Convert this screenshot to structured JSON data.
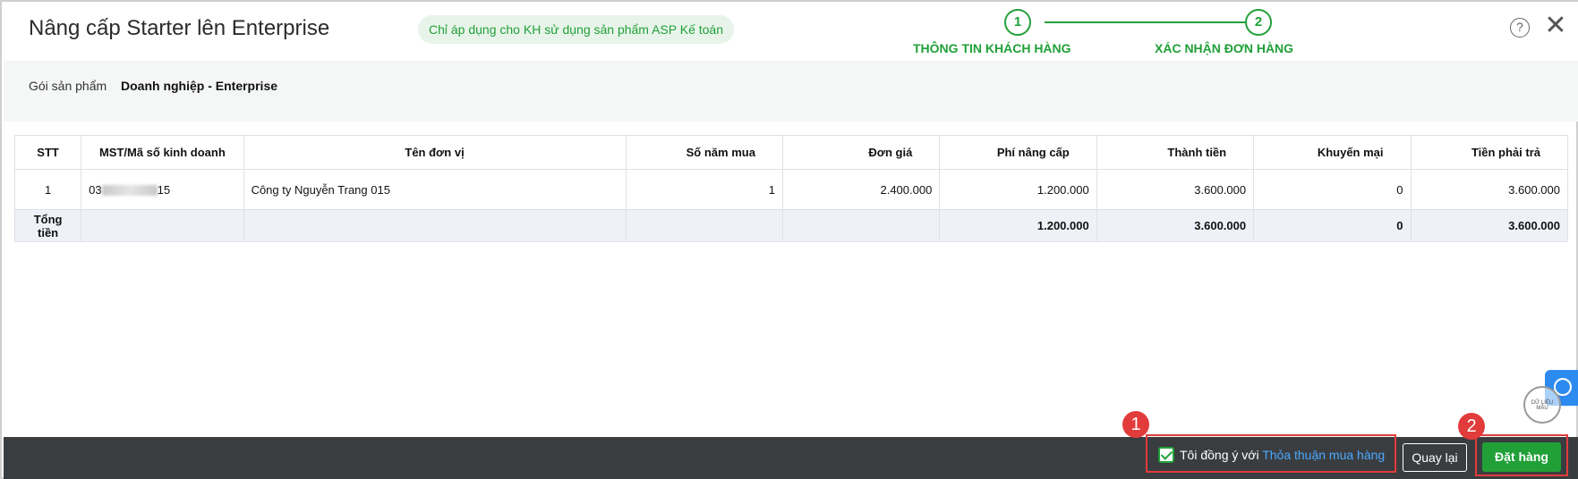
{
  "header": {
    "title": "Nâng cấp Starter lên Enterprise",
    "note": "Chỉ áp dụng cho KH sử dụng sản phẩm ASP Kế toán",
    "steps": [
      {
        "number": "1",
        "label": "THÔNG TIN KHÁCH HÀNG"
      },
      {
        "number": "2",
        "label": "XÁC NHẬN ĐƠN HÀNG"
      }
    ],
    "help_label": "?",
    "close_label": "✕"
  },
  "product": {
    "label": "Gói sản phẩm",
    "value": "Doanh nghiệp - Enterprise"
  },
  "table": {
    "headers": [
      "STT",
      "MST/Mã số kinh doanh",
      "Tên đơn vị",
      "Số năm mua",
      "Đơn giá",
      "Phí nâng cấp",
      "Thành tiền",
      "Khuyến mại",
      "Tiền phải trả"
    ],
    "rows": [
      {
        "stt": "1",
        "mst_prefix": "03",
        "mst_suffix": "15",
        "ten_don_vi": "Công ty Nguyễn Trang 015",
        "so_nam_mua": "1",
        "don_gia": "2.400.000",
        "phi_nang_cap": "1.200.000",
        "thanh_tien": "3.600.000",
        "khuyen_mai": "0",
        "tien_phai_tra": "3.600.000"
      }
    ],
    "total": {
      "label": "Tổng tiền",
      "phi_nang_cap": "1.200.000",
      "thanh_tien": "3.600.000",
      "khuyen_mai": "0",
      "tien_phai_tra": "3.600.000"
    }
  },
  "footer": {
    "agree_text": "Tôi đồng ý với",
    "agree_link": "Thỏa thuận mua hàng",
    "agree_checked": true,
    "back_label": "Quay lại",
    "order_label": "Đặt hàng",
    "markers": [
      "1",
      "2"
    ]
  },
  "watermark": "DỮ LIỆU MẪU",
  "colors": {
    "accent_green": "#21a038",
    "link_blue": "#4aa8ff",
    "annotation_red": "#e23b3b",
    "footer_bg": "#3a3d40"
  }
}
